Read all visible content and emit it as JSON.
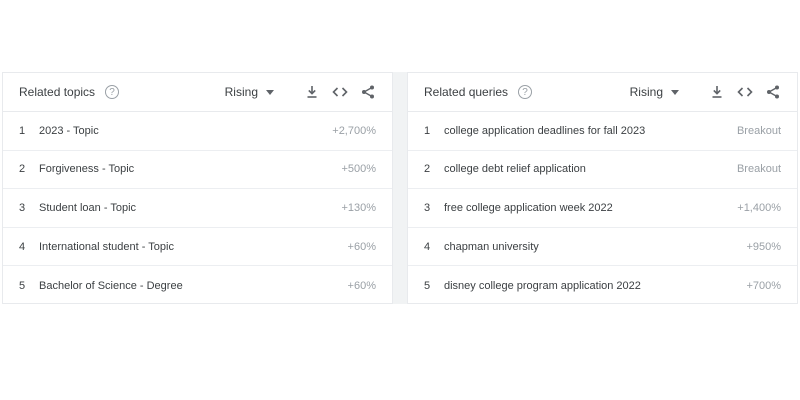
{
  "related_topics": {
    "title": "Related topics",
    "help_glyph": "?",
    "filter": "Rising",
    "rows": [
      {
        "rank": "1",
        "label": "2023 - Topic",
        "value": "+2,700%"
      },
      {
        "rank": "2",
        "label": "Forgiveness - Topic",
        "value": "+500%"
      },
      {
        "rank": "3",
        "label": "Student loan - Topic",
        "value": "+130%"
      },
      {
        "rank": "4",
        "label": "International student - Topic",
        "value": "+60%"
      },
      {
        "rank": "5",
        "label": "Bachelor of Science - Degree",
        "value": "+60%"
      }
    ]
  },
  "related_queries": {
    "title": "Related queries",
    "help_glyph": "?",
    "filter": "Rising",
    "rows": [
      {
        "rank": "1",
        "label": "college application deadlines for fall 2023",
        "value": "Breakout"
      },
      {
        "rank": "2",
        "label": "college debt relief application",
        "value": "Breakout"
      },
      {
        "rank": "3",
        "label": "free college application week 2022",
        "value": "+1,400%"
      },
      {
        "rank": "4",
        "label": "chapman university",
        "value": "+950%"
      },
      {
        "rank": "5",
        "label": "disney college program application 2022",
        "value": "+700%"
      }
    ]
  },
  "icons": {
    "help": "help-circle-icon",
    "dropdown": "caret-down-icon",
    "download": "download-icon",
    "embed": "code-brackets-icon",
    "share": "share-icon"
  },
  "colors": {
    "text": "#3c4043",
    "muted": "#9aa0a6",
    "border": "#e8eaed",
    "gutter": "#f1f3f4"
  }
}
